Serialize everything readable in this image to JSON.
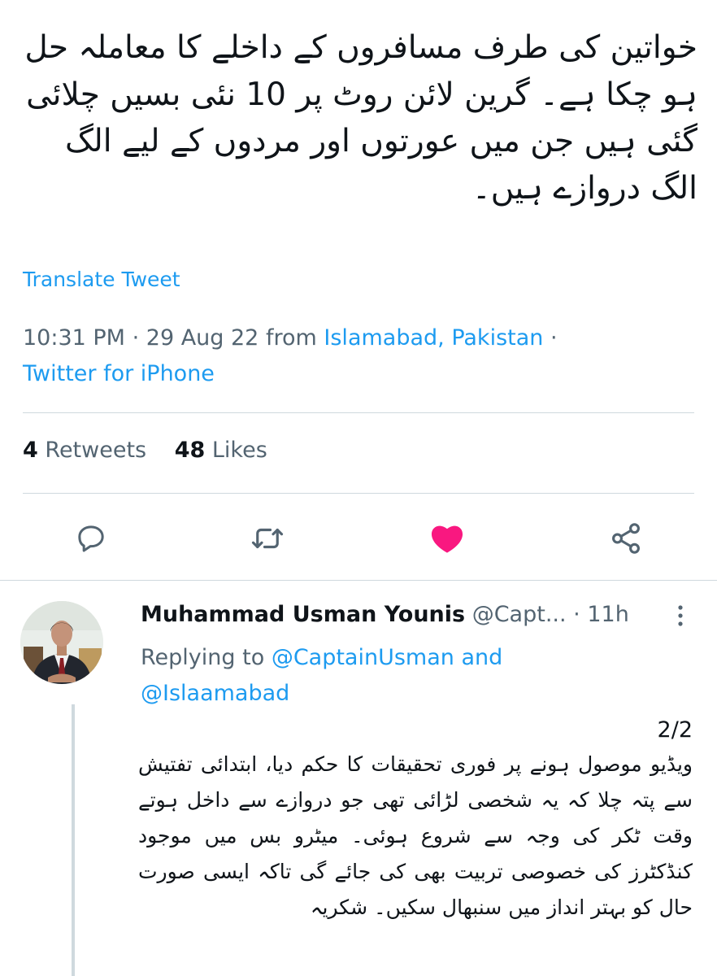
{
  "tweet": {
    "text": "خواتین کی طرف مسافروں کے داخلے کا معاملہ حل ہو چکا ہے۔ گرین لائن روٹ پر 10 نئی بسیں چلائی گئی ہیں جن میں عورتوں اور مردوں کے لیے الگ الگ دروازے ہیں۔",
    "translate_label": "Translate Tweet",
    "time": "10:31 PM",
    "date": "29 Aug 22",
    "from_label": "from",
    "location": "Islamabad, Pakistan",
    "separator": "·",
    "client": "Twitter for iPhone",
    "retweets_count": "4",
    "retweets_label": "Retweets",
    "likes_count": "48",
    "likes_label": "Likes"
  },
  "actions": {
    "reply_icon": "reply-icon",
    "retweet_icon": "retweet-icon",
    "like_icon": "heart-icon",
    "share_icon": "share-icon",
    "liked": true
  },
  "reply": {
    "author_name": "Muhammad Usman Younis",
    "handle": "@Capt...",
    "time_ago": "· 11h",
    "replying_label": "Replying to",
    "mention_1": "@CaptainUsman",
    "and_label": "and",
    "mention_2": "@Islaamabad",
    "counter": "2/2",
    "text": "ویڈیو موصول ہونے پر فوری تحقیقات کا حکم دیا، ابتدائی تفتیش سے پتہ چلا کہ یہ شخصی لڑائی تھی جو دروازے سے داخل ہوتے وقت ٹکر کی وجہ سے شروع ہوئی۔ میٹرو بس میں موجود کنڈکٹرز کی خصوصی تربیت بھی کی جائے گی تاکہ ایسی صورت حال کو بہتر انداز میں سنبھال سکیں۔ شکریہ"
  },
  "colors": {
    "text": "#0f1419",
    "secondary": "#536471",
    "link": "#1d9bf0",
    "like": "#f91880",
    "divider": "#cfd9de"
  }
}
